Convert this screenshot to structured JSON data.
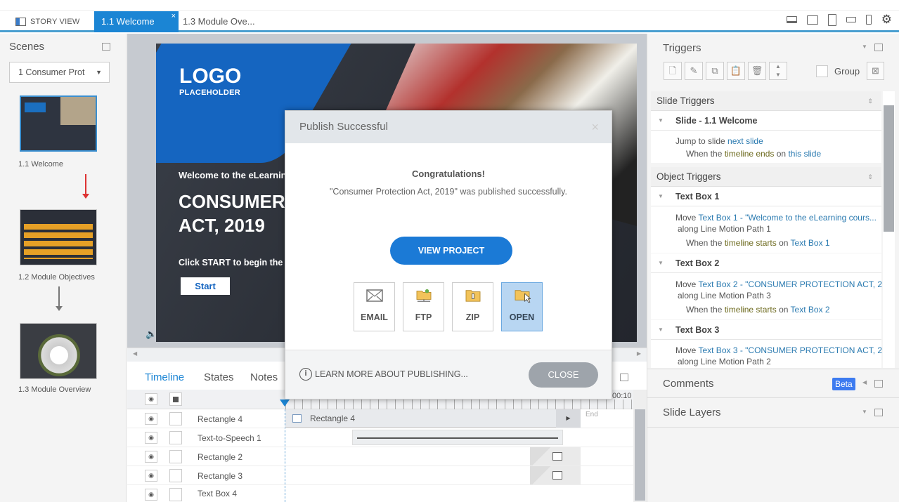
{
  "tabs": {
    "story_view": "STORY VIEW",
    "active": "1.1 Welcome",
    "close": "×",
    "other": "1.3 Module Ove..."
  },
  "scenes": {
    "title": "Scenes",
    "dropdown": "1 Consumer Prot",
    "slides": [
      {
        "label": "1.1 Welcome"
      },
      {
        "label": "1.2 Module Objectives"
      },
      {
        "label": "1.3 Module Overview"
      }
    ]
  },
  "slide": {
    "logo": "LOGO",
    "logo_sub": "PLACEHOLDER",
    "welcome": "Welcome to the eLearning",
    "title1": "CONSUMER P",
    "title2": "ACT, 2019",
    "prompt": "Click START to begin the cour",
    "start": "Start"
  },
  "dialog": {
    "title": "Publish Successful",
    "close_x": "×",
    "heading": "Congratulations!",
    "message": "\"Consumer Protection Act, 2019\" was published successfully.",
    "view_project": "VIEW PROJECT",
    "options": [
      "EMAIL",
      "FTP",
      "ZIP",
      "OPEN"
    ],
    "learn_more": "LEARN MORE ABOUT PUBLISHING...",
    "close": "CLOSE"
  },
  "timeline": {
    "tabs": [
      "Timeline",
      "States",
      "Notes"
    ],
    "ruler_end": "00:10",
    "end_label": "End",
    "rows": [
      {
        "name": "Rectangle 4",
        "bar": "Rectangle 4"
      },
      {
        "name": "Text-to-Speech 1"
      },
      {
        "name": "Rectangle 2"
      },
      {
        "name": "Rectangle 3"
      },
      {
        "name": "Text Box 4"
      }
    ]
  },
  "triggers": {
    "title": "Triggers",
    "group": "Group",
    "slide_triggers": "Slide Triggers",
    "object_triggers": "Object Triggers",
    "slide_item": "Slide - 1.1 Welcome",
    "slide_action": {
      "a": "Jump to slide ",
      "b": "next slide",
      "c": "When the ",
      "d": "timeline ends",
      "e": " on ",
      "f": "this slide"
    },
    "objects": [
      {
        "name": "Text Box 1",
        "a": "Move ",
        "b": "Text Box 1 - \"Welcome to the eLearning cours...",
        "c": "along Line Motion Path 1",
        "d": "When the ",
        "e": "timeline starts",
        "f": " on ",
        "g": "Text Box 1"
      },
      {
        "name": "Text Box 2",
        "a": "Move ",
        "b": "Text Box 2 - \"CONSUMER PROTECTION ACT, 2...",
        "c": "along Line Motion Path 3",
        "d": "When the ",
        "e": "timeline starts",
        "f": " on ",
        "g": "Text Box 2"
      },
      {
        "name": "Text Box 3",
        "a": "Move ",
        "b": "Text Box 3 - \"CONSUMER PROTECTION ACT, 2...",
        "c": "along Line Motion Path 2"
      }
    ]
  },
  "comments": {
    "title": "Comments",
    "badge": "Beta"
  },
  "layers": {
    "title": "Slide Layers"
  },
  "colors": {
    "accent": "#1b85d4",
    "beta": "#3d7bf0",
    "link": "#2a7ab0"
  }
}
